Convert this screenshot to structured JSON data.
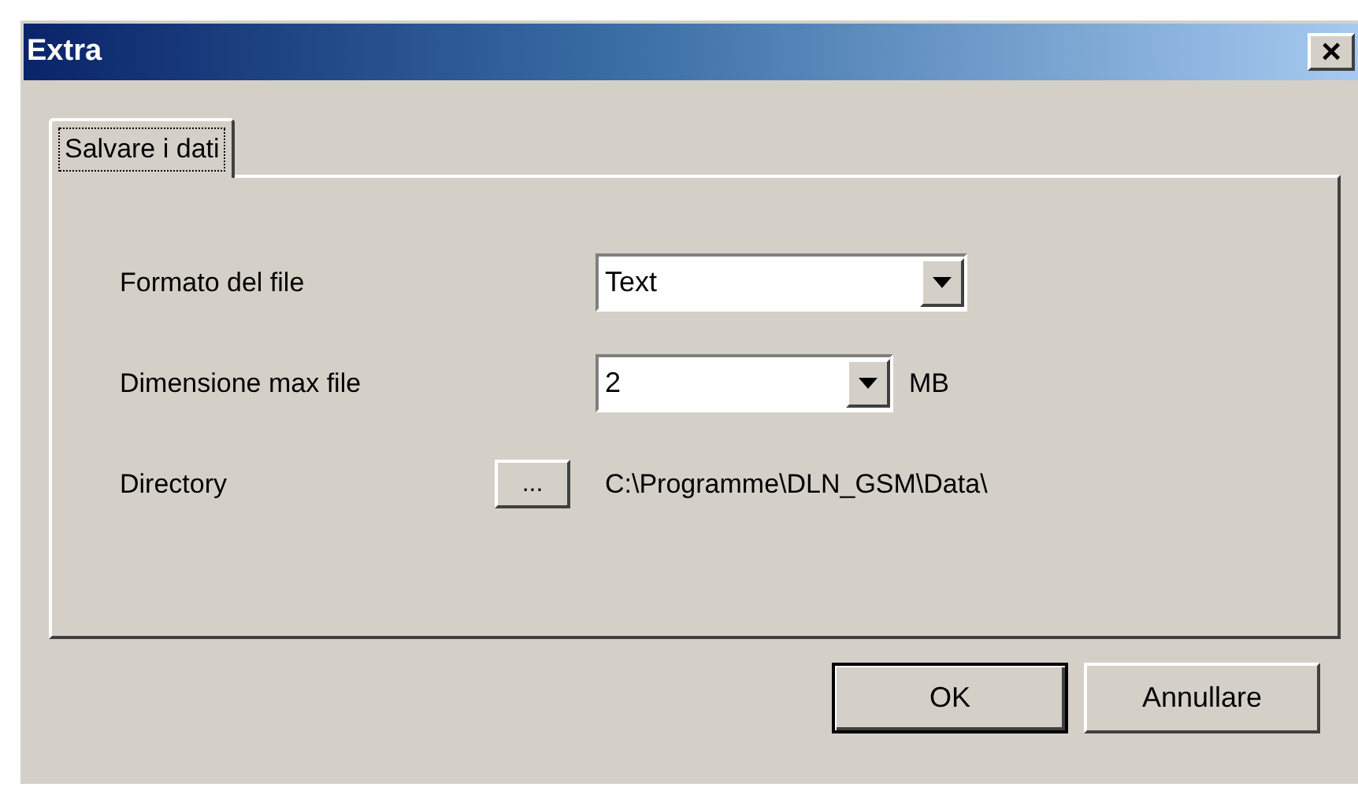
{
  "window": {
    "title": "Extra",
    "close": "×"
  },
  "tabs": [
    {
      "label": "Salvare i dati",
      "selected": true
    }
  ],
  "fields": [
    {
      "kind": "combo",
      "label": "Formato del file",
      "value": "Text",
      "wide": true
    },
    {
      "kind": "combo",
      "label": "Dimensione max file",
      "value": "2",
      "unit": "MB",
      "wide": false
    },
    {
      "kind": "browse",
      "label": "Directory",
      "button": "...",
      "value": "C:\\Programme\\DLN_GSM\\Data\\"
    }
  ],
  "buttons": [
    {
      "label": "OK",
      "default": true
    },
    {
      "label": "Annullare",
      "default": false
    }
  ]
}
